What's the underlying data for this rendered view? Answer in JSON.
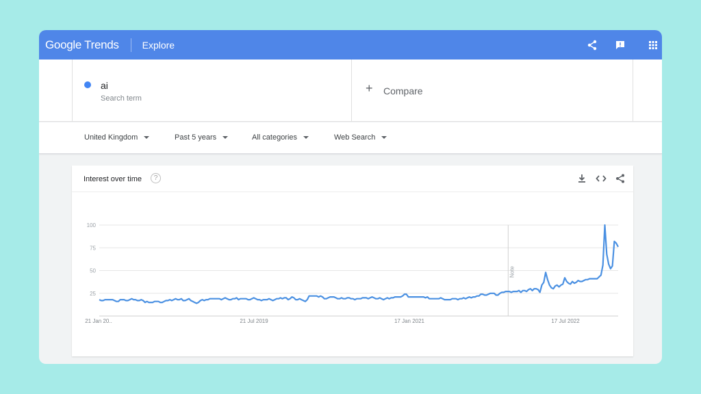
{
  "header": {
    "logo_text": "Google Trends",
    "page_title": "Explore",
    "icons": [
      "share-icon",
      "feedback-icon",
      "apps-grid-icon"
    ],
    "brand_color": "#4f86e8"
  },
  "search": {
    "term": "ai",
    "term_sublabel": "Search term",
    "term_color": "#4285f4",
    "compare_label": "Compare"
  },
  "filters": {
    "region": "United Kingdom",
    "time": "Past 5 years",
    "category": "All categories",
    "property": "Web Search"
  },
  "card": {
    "title": "Interest over time",
    "help_glyph": "?",
    "icons": [
      "download-icon",
      "embed-icon",
      "share-icon"
    ]
  },
  "chart_data": {
    "type": "line",
    "title": "Interest over time",
    "xlabel": "",
    "ylabel": "",
    "ylim": [
      0,
      100
    ],
    "yticks": [
      25,
      50,
      75,
      100
    ],
    "x_tick_labels": [
      "21 Jan 20..",
      "21 Jul 2019",
      "17 Jan 2021",
      "17 Jul 2022"
    ],
    "annotation": {
      "label": "Note",
      "x_fraction": 0.788
    },
    "grid": true,
    "line_color": "#4a90e2",
    "series": [
      {
        "values": [
          18,
          17,
          17,
          18,
          18,
          18,
          18,
          18,
          17,
          16,
          16,
          18,
          18,
          18,
          17,
          17,
          18,
          19,
          18,
          18,
          17,
          17,
          18,
          17,
          15,
          16,
          15,
          15,
          15,
          16,
          16,
          16,
          15,
          15,
          16,
          17,
          17,
          18,
          17,
          18,
          19,
          18,
          18,
          19,
          17,
          17,
          18,
          19,
          17,
          16,
          15,
          14,
          15,
          17,
          18,
          17,
          18,
          18,
          19,
          19,
          19,
          19,
          19,
          19,
          18,
          19,
          20,
          19,
          18,
          18,
          19,
          19,
          20,
          18,
          19,
          19,
          19,
          19,
          18,
          18,
          19,
          20,
          19,
          18,
          18,
          17,
          18,
          18,
          18,
          19,
          18,
          17,
          18,
          19,
          19,
          20,
          19,
          20,
          20,
          18,
          19,
          21,
          20,
          18,
          18,
          19,
          18,
          17,
          16,
          18,
          22,
          22,
          22,
          22,
          22,
          21,
          22,
          21,
          19,
          19,
          20,
          21,
          21,
          21,
          20,
          19,
          19,
          20,
          19,
          19,
          20,
          20,
          19,
          19,
          18,
          19,
          19,
          19,
          20,
          20,
          20,
          19,
          20,
          21,
          20,
          19,
          19,
          20,
          19,
          18,
          19,
          20,
          19,
          20,
          20,
          21,
          21,
          21,
          21,
          22,
          24,
          24,
          21,
          21,
          21,
          21,
          21,
          21,
          21,
          21,
          21,
          20,
          21,
          19,
          19,
          19,
          19,
          19,
          19,
          20,
          19,
          18,
          18,
          18,
          18,
          19,
          19,
          19,
          18,
          19,
          19,
          20,
          19,
          20,
          21,
          20,
          21,
          21,
          22,
          22,
          24,
          24,
          23,
          23,
          24,
          25,
          25,
          25,
          23,
          23,
          25,
          26,
          26,
          27,
          27,
          27,
          26,
          27,
          27,
          27,
          28,
          26,
          28,
          28,
          27,
          29,
          30,
          28,
          30,
          30,
          29,
          26,
          34,
          37,
          48,
          40,
          34,
          31,
          30,
          33,
          34,
          32,
          34,
          35,
          42,
          38,
          36,
          35,
          38,
          36,
          37,
          39,
          38,
          38,
          39,
          40,
          40,
          41,
          41,
          41,
          41,
          41,
          43,
          45,
          56,
          100,
          68,
          57,
          52,
          55,
          82,
          80,
          76
        ]
      }
    ]
  }
}
